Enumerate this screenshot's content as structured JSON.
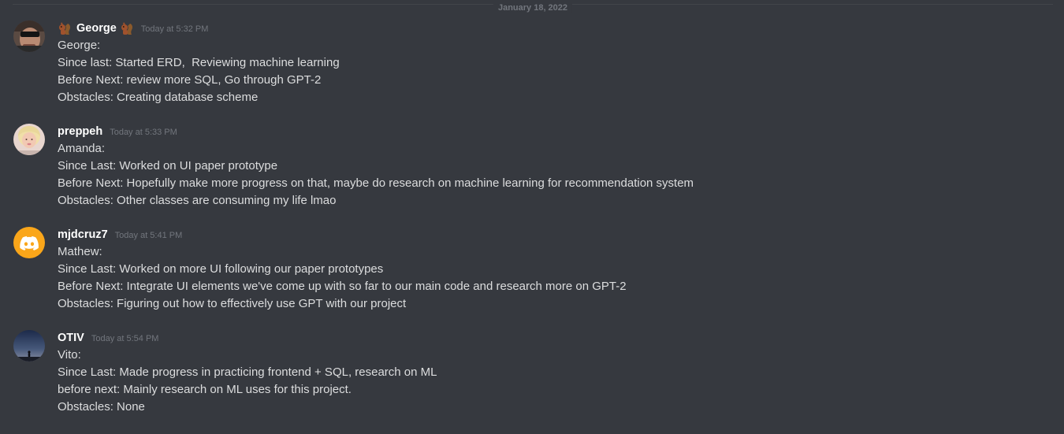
{
  "divider": {
    "date": "January 18, 2022"
  },
  "messages": [
    {
      "username": "George",
      "timestamp": "Today at 5:32 PM",
      "avatar": "avatar-george",
      "name_emoji": "squirrel-emoji",
      "lines": [
        "George:",
        "Since last: Started ERD,  Reviewing machine learning",
        "Before Next: review more SQL, Go through GPT-2",
        "Obstacles: Creating database scheme"
      ]
    },
    {
      "username": "preppeh",
      "timestamp": "Today at 5:33 PM",
      "avatar": "avatar-preppeh",
      "lines": [
        "Amanda:",
        "Since Last: Worked on UI paper prototype",
        "Before Next: Hopefully make more progress on that, maybe do research on machine learning for recommendation system",
        "Obstacles: Other classes are consuming my life lmao"
      ]
    },
    {
      "username": "mjdcruz7",
      "timestamp": "Today at 5:41 PM",
      "avatar": "discord-default-avatar",
      "avatar_color": "#faa61a",
      "lines": [
        "Mathew:",
        "Since Last: Worked on more UI following our paper prototypes",
        "Before Next: Integrate UI elements we've come up with so far to our main code and research more on GPT-2",
        "Obstacles: Figuring out how to effectively use GPT with our project"
      ]
    },
    {
      "username": "OTIV",
      "timestamp": "Today at 5:54 PM",
      "avatar": "avatar-otiv",
      "lines": [
        "Vito:",
        "Since Last: Made progress in practicing frontend + SQL, research on ML",
        "before next: Mainly research on ML uses for this project.",
        "Obstacles: None"
      ]
    }
  ]
}
